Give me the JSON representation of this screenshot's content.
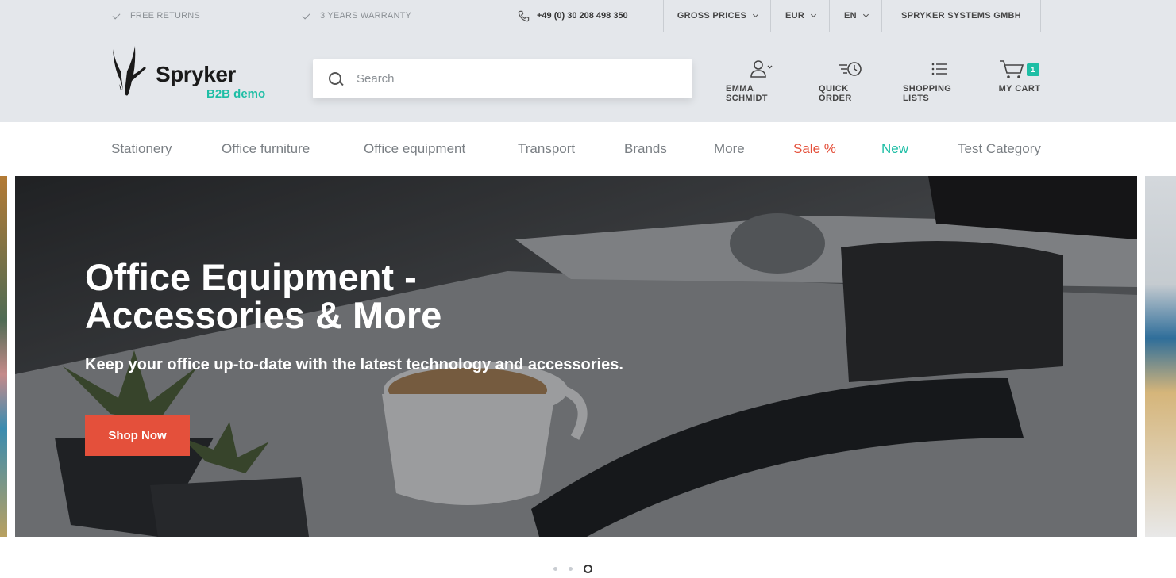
{
  "topbar": {
    "free_returns": "FREE RETURNS",
    "warranty": "3 YEARS WARRANTY",
    "phone": "+49 (0) 30 208 498 350",
    "price_mode": "GROSS PRICES",
    "currency": "EUR",
    "language": "EN",
    "company": "SPRYKER SYSTEMS GMBH"
  },
  "logo": {
    "name": "Spryker",
    "subtitle": "B2B demo"
  },
  "search": {
    "placeholder": "Search"
  },
  "header_nav": {
    "user": "EMMA SCHMIDT",
    "quick_order": "QUICK ORDER",
    "shopping_lists": "SHOPPING LISTS",
    "cart": "MY CART",
    "cart_count": "1"
  },
  "categories": [
    "Stationery",
    "Office furniture",
    "Office equipment",
    "Transport",
    "Brands",
    "More",
    "Sale %",
    "New",
    "Test Category"
  ],
  "hero": {
    "title_line1": "Office Equipment -",
    "title_line2": "Accessories & More",
    "subtitle": "Keep your office up-to-date with the latest technology and accessories.",
    "button": "Shop Now"
  },
  "slider": {
    "slide_count": 3,
    "active_slide": 3
  },
  "colors": {
    "accent_green": "#1ebea5",
    "accent_red": "#e4503b",
    "topbar_bg": "#e4e7eb"
  }
}
